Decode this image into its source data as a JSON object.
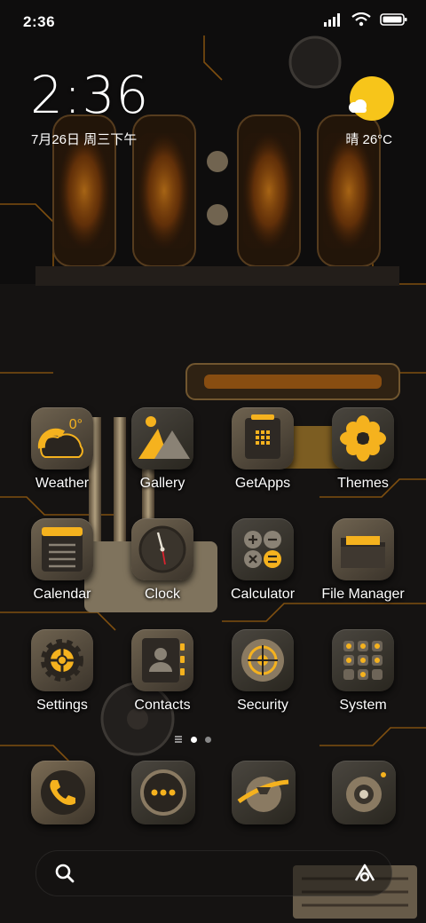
{
  "status_bar": {
    "time": "2:36",
    "icons": [
      "signal-icon",
      "wifi-icon",
      "battery-icon"
    ]
  },
  "lock_widget": {
    "time": "2:36",
    "date": "7月26日 周三下午",
    "weather": "晴 26°C"
  },
  "apps": [
    {
      "name": "weather",
      "label": "Weather",
      "badge": "0°"
    },
    {
      "name": "gallery",
      "label": "Gallery"
    },
    {
      "name": "getapps",
      "label": "GetApps"
    },
    {
      "name": "themes",
      "label": "Themes"
    },
    {
      "name": "calendar",
      "label": "Calendar"
    },
    {
      "name": "clock",
      "label": "Clock"
    },
    {
      "name": "calculator",
      "label": "Calculator"
    },
    {
      "name": "file-manager",
      "label": "File Manager"
    },
    {
      "name": "settings",
      "label": "Settings"
    },
    {
      "name": "contacts",
      "label": "Contacts"
    },
    {
      "name": "security",
      "label": "Security"
    },
    {
      "name": "system",
      "label": "System"
    }
  ],
  "page_indicator": {
    "pages": 2,
    "current": 1
  },
  "dock": [
    "phone-icon",
    "messages-icon",
    "browser-icon",
    "camera-icon"
  ],
  "search": {
    "left_icon": "search-icon",
    "right_icon": "assistant-icon"
  },
  "colors": {
    "accent": "#f5b21e",
    "tile": "#5a4f40",
    "label": "#ffffff"
  }
}
